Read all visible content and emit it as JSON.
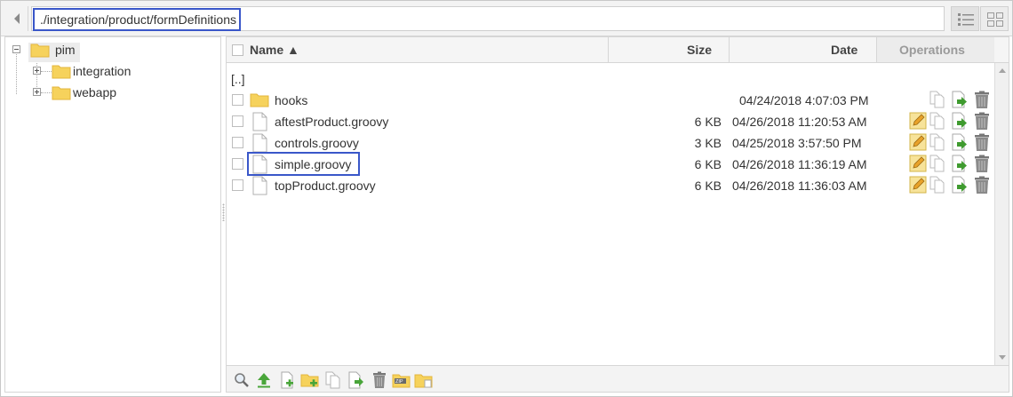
{
  "toolbar": {
    "path": "./integration/product/formDefinitions"
  },
  "tree": {
    "root": "pim",
    "children": [
      "integration",
      "webapp"
    ]
  },
  "table": {
    "headers": {
      "name": "Name ▲",
      "size": "Size",
      "date": "Date",
      "operations": "Operations"
    },
    "parent_link": "[..]",
    "rows": [
      {
        "name": "hooks",
        "type": "folder",
        "size": "",
        "date": "04/24/2018 4:07:03 PM",
        "selected": false
      },
      {
        "name": "aftestProduct.groovy",
        "type": "file",
        "size": "6 KB",
        "date": "04/26/2018 11:20:53 AM",
        "selected": false
      },
      {
        "name": "controls.groovy",
        "type": "file",
        "size": "3 KB",
        "date": "04/25/2018 3:57:50 PM",
        "selected": false
      },
      {
        "name": "simple.groovy",
        "type": "file",
        "size": "6 KB",
        "date": "04/26/2018 11:36:19 AM",
        "selected": true
      },
      {
        "name": "topProduct.groovy",
        "type": "file",
        "size": "6 KB",
        "date": "04/26/2018 11:36:03 AM",
        "selected": false
      }
    ]
  },
  "icons": {
    "back": "chevron-left-icon",
    "list_view": "list-view-icon",
    "grid_view": "grid-view-icon",
    "folder": "folder-icon",
    "file": "file-icon",
    "edit": "pencil-icon",
    "copy": "copy-icon",
    "move": "move-icon",
    "delete": "trash-icon",
    "bottom_tools": [
      "search-icon",
      "upload-icon",
      "new-file-icon",
      "new-folder-icon",
      "copy-icon",
      "move-icon",
      "trash-icon",
      "zip-icon",
      "unzip-icon"
    ]
  },
  "colors": {
    "highlight": "#3a57c9",
    "folder": "#f6d25c",
    "move_arrow": "#3f9b2f"
  }
}
